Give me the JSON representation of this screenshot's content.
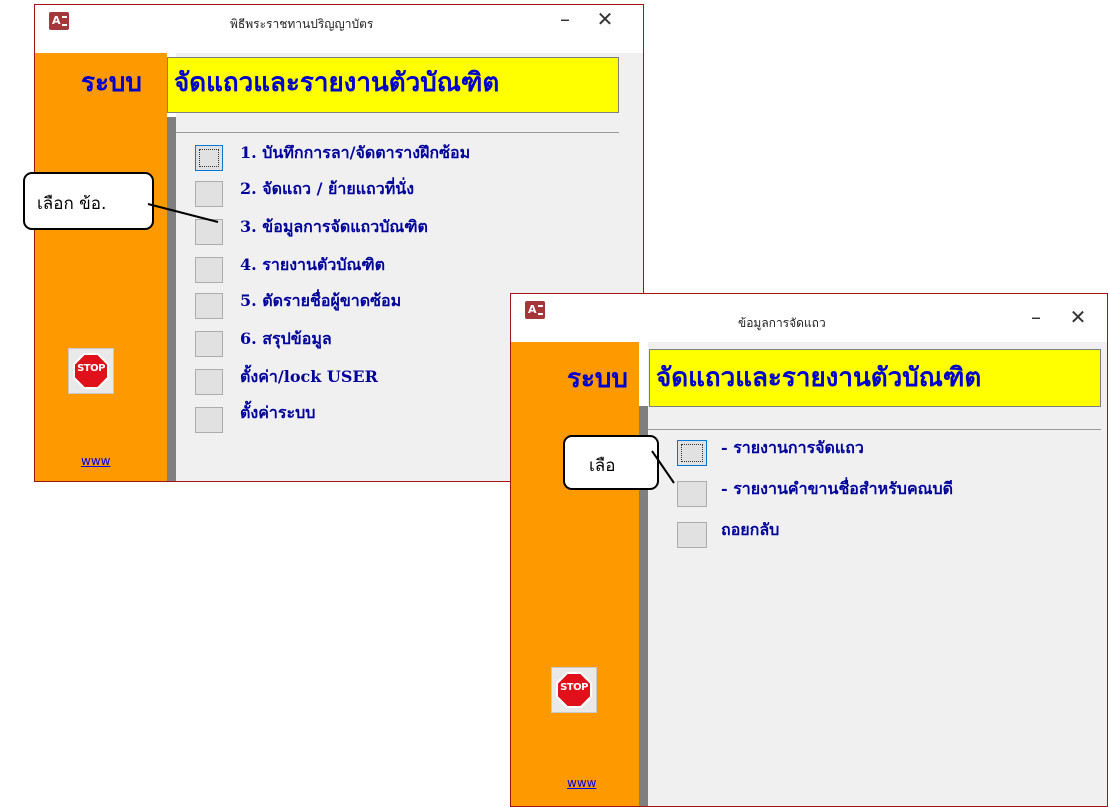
{
  "window1": {
    "title": "พิธีพระราชทานปริญญาบัตร",
    "banner_prefix": "ระบบ",
    "banner_main": "จัดแถวและรายงานตัวบัณฑิต",
    "menu": [
      "1. บันทึกการลา/จัดตารางฝึกซ้อม",
      "2. จัดแถว / ย้ายแถวที่นั่ง",
      "3. ข้อมูลการจัดแถวบัณฑิต",
      "4. รายงานตัวบัณฑิต",
      "5. ตัดรายชื่อผู้ขาดซ้อม",
      "6. สรุปข้อมูล",
      "ตั้งค่า/lock USER",
      "ตั้งค่าระบบ"
    ],
    "stop_label": "STOP",
    "link": "www",
    "minimize": "–",
    "close": "✕"
  },
  "window2": {
    "title": "ข้อมูลการจัดแถว",
    "banner_prefix": "ระบบ",
    "banner_main": "จัดแถวและรายงานตัวบัณฑิต",
    "menu": [
      "- รายงานการจัดแถว",
      "- รายงานคำขานชื่อสำหรับคณบดี",
      "ถอยกลับ"
    ],
    "stop_label": "STOP",
    "link": "www",
    "minimize": "–",
    "close": "✕"
  },
  "callouts": {
    "c1": "เลือก ข้อ.",
    "c2": "เลือ"
  },
  "colors": {
    "sidebar": "#ff9900",
    "banner_bg": "#ffff00",
    "text_blue": "#0000cc",
    "border": "#a31515"
  }
}
